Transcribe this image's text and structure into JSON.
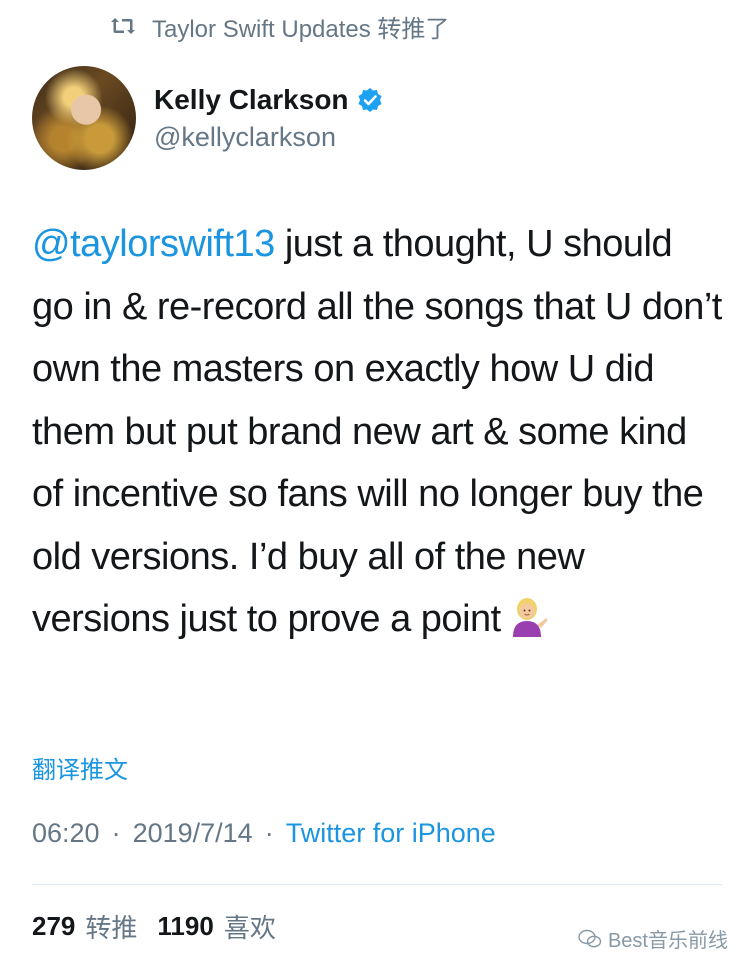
{
  "retweet_header": {
    "icon": "retweet-icon",
    "text": "Taylor Swift Updates 转推了"
  },
  "author": {
    "name": "Kelly Clarkson",
    "handle": "@kellyclarkson",
    "verified": true,
    "verified_color": "#1da1f2"
  },
  "tweet": {
    "mention": "@taylorswift13",
    "text": " just a thought, U should go in & re-record all the songs that U don’t own the masters on exactly how U did them but put brand new art & some kind of incentive so fans will no longer buy the old versions. I’d buy all of the new versions just to prove a point",
    "emoji": "woman-tipping-hand-emoji"
  },
  "translate_link": "翻译推文",
  "meta": {
    "time": "06:20",
    "date": "2019/7/14",
    "source": "Twitter for iPhone"
  },
  "stats": {
    "retweets": "279",
    "retweets_label": "转推",
    "likes": "1190",
    "likes_label": "喜欢"
  },
  "watermark": "Best音乐前线",
  "colors": {
    "link": "#1b95e0",
    "muted": "#657786",
    "text": "#14171a"
  }
}
